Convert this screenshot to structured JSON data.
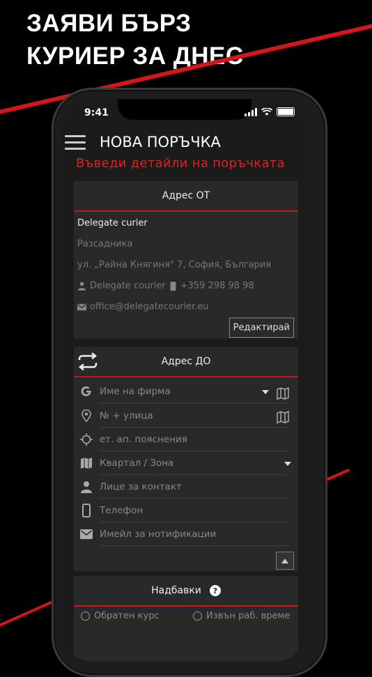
{
  "headline": {
    "line1": "ЗАЯВИ БЪРЗ",
    "line2": "КУРИЕР ЗА ДНЕС"
  },
  "status_bar": {
    "time": "9:41"
  },
  "header": {
    "title": "НОВА ПОРЪЧКА",
    "subtitle": "Въведи детайли на поръчката"
  },
  "from_card": {
    "title": "Адрес ОТ",
    "company": "Delegate curier",
    "district": "Разсадника",
    "address": "ул. „Райна Княгиня\" 7, София, България",
    "contact_name": "Delegate courier",
    "phone": "+359 298 98 98",
    "email": "office@delegatecourier.eu",
    "edit_label": "Редактирай"
  },
  "to_card": {
    "title": "Адрес ДО",
    "fields": [
      {
        "placeholder": "Име на фирма"
      },
      {
        "placeholder": "№ + улица"
      },
      {
        "placeholder": "ет. ап. пояснения"
      },
      {
        "placeholder": "Квартал / Зона"
      },
      {
        "placeholder": "Лице за контакт"
      },
      {
        "placeholder": "Телефон"
      },
      {
        "placeholder": "Имейл за нотификации"
      }
    ]
  },
  "extras_card": {
    "title": "Надбавки",
    "help": "?",
    "options": [
      "Обратен курс",
      "Извън раб. време"
    ]
  },
  "colors": {
    "accent": "#d4161c",
    "background": "#000000",
    "card": "#292929"
  }
}
